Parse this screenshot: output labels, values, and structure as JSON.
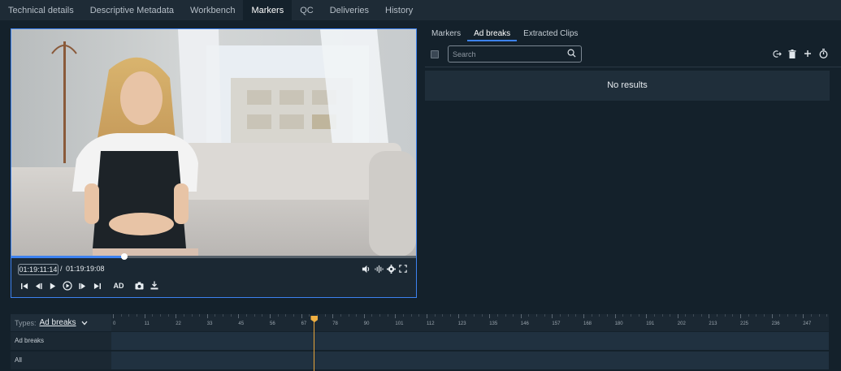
{
  "top_tabs": [
    {
      "label": "Technical details"
    },
    {
      "label": "Descriptive Metadata"
    },
    {
      "label": "Workbench"
    },
    {
      "label": "Markers",
      "active": true
    },
    {
      "label": "QC"
    },
    {
      "label": "Deliveries"
    },
    {
      "label": "History"
    }
  ],
  "player": {
    "current_timecode": "01:19:11:14",
    "separator": "/",
    "total_timecode": "01:19:19:08",
    "progress_fraction": 0.28,
    "ad_label": "AD",
    "icons": [
      "volume-icon",
      "waveform-icon",
      "settings-icon",
      "fullscreen-icon",
      "skip-start-icon",
      "step-back-icon",
      "play-icon",
      "loop-icon",
      "step-forward-icon",
      "skip-end-icon",
      "camera-icon",
      "download-icon"
    ]
  },
  "right_panel": {
    "tabs": [
      {
        "label": "Markers"
      },
      {
        "label": "Ad breaks",
        "active": true
      },
      {
        "label": "Extracted Clips"
      }
    ],
    "search_placeholder": "Search",
    "empty_message": "No results",
    "icons": [
      "export-icon",
      "trash-icon",
      "add-icon",
      "timer-icon"
    ]
  },
  "timeline": {
    "types_label": "Types:",
    "types_value": "Ad breaks",
    "ticks": [
      "0",
      "11",
      "22",
      "33",
      "45",
      "56",
      "67",
      "78",
      "90",
      "101",
      "112",
      "123",
      "135",
      "146",
      "157",
      "168",
      "180",
      "191",
      "202",
      "213",
      "225",
      "236",
      "247"
    ],
    "rows": [
      {
        "label": "Ad breaks"
      },
      {
        "label": "All"
      }
    ],
    "playhead_value": 72
  },
  "colors": {
    "accent": "#3d82f0",
    "playhead": "#f0b042",
    "background": "#14212b"
  }
}
